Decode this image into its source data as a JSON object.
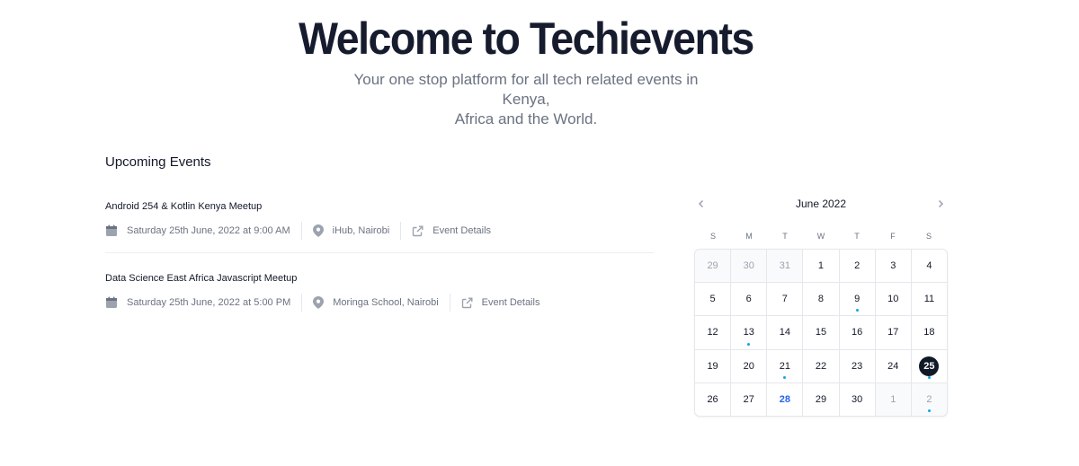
{
  "hero": {
    "title": "Welcome to Techievents",
    "subtitle_line1": "Your one stop platform for all tech related events in Kenya,",
    "subtitle_line2": "Africa and the World."
  },
  "upcoming": {
    "title": "Upcoming Events",
    "events": [
      {
        "title": "Android 254 & Kotlin Kenya Meetup",
        "datetime": "Saturday 25th June, 2022 at 9:00 AM",
        "location": "iHub, Nairobi",
        "link_label": "Event Details"
      },
      {
        "title": "Data Science East Africa Javascript Meetup",
        "datetime": "Saturday 25th June, 2022 at 5:00 PM",
        "location": "Moringa School, Nairobi",
        "link_label": "Event Details"
      }
    ]
  },
  "calendar": {
    "month_label": "June 2022",
    "weekdays": [
      "S",
      "M",
      "T",
      "W",
      "T",
      "F",
      "S"
    ],
    "days": [
      {
        "label": "29",
        "current_month": false,
        "dot": false
      },
      {
        "label": "30",
        "current_month": false,
        "dot": false
      },
      {
        "label": "31",
        "current_month": false,
        "dot": false
      },
      {
        "label": "1",
        "current_month": true,
        "dot": false
      },
      {
        "label": "2",
        "current_month": true,
        "dot": false
      },
      {
        "label": "3",
        "current_month": true,
        "dot": false
      },
      {
        "label": "4",
        "current_month": true,
        "dot": false
      },
      {
        "label": "5",
        "current_month": true,
        "dot": false
      },
      {
        "label": "6",
        "current_month": true,
        "dot": false
      },
      {
        "label": "7",
        "current_month": true,
        "dot": false
      },
      {
        "label": "8",
        "current_month": true,
        "dot": false
      },
      {
        "label": "9",
        "current_month": true,
        "dot": true
      },
      {
        "label": "10",
        "current_month": true,
        "dot": false
      },
      {
        "label": "11",
        "current_month": true,
        "dot": false
      },
      {
        "label": "12",
        "current_month": true,
        "dot": false
      },
      {
        "label": "13",
        "current_month": true,
        "dot": true
      },
      {
        "label": "14",
        "current_month": true,
        "dot": false
      },
      {
        "label": "15",
        "current_month": true,
        "dot": false
      },
      {
        "label": "16",
        "current_month": true,
        "dot": false
      },
      {
        "label": "17",
        "current_month": true,
        "dot": false
      },
      {
        "label": "18",
        "current_month": true,
        "dot": false
      },
      {
        "label": "19",
        "current_month": true,
        "dot": false
      },
      {
        "label": "20",
        "current_month": true,
        "dot": false
      },
      {
        "label": "21",
        "current_month": true,
        "dot": true
      },
      {
        "label": "22",
        "current_month": true,
        "dot": false
      },
      {
        "label": "23",
        "current_month": true,
        "dot": false
      },
      {
        "label": "24",
        "current_month": true,
        "dot": false
      },
      {
        "label": "25",
        "current_month": true,
        "dot": true,
        "selected": true
      },
      {
        "label": "26",
        "current_month": true,
        "dot": false
      },
      {
        "label": "27",
        "current_month": true,
        "dot": false
      },
      {
        "label": "28",
        "current_month": true,
        "dot": false,
        "today": true
      },
      {
        "label": "29",
        "current_month": true,
        "dot": false
      },
      {
        "label": "30",
        "current_month": true,
        "dot": false
      },
      {
        "label": "1",
        "current_month": false,
        "dot": false
      },
      {
        "label": "2",
        "current_month": false,
        "dot": true
      }
    ]
  },
  "colors": {
    "heading": "#161b2e",
    "muted": "#6b7280",
    "today": "#2563eb",
    "selected_bg": "#111827",
    "event_dot": "#0ea5e9"
  },
  "icons": {
    "date": "calendar-icon",
    "location": "map-pin-icon",
    "link": "external-link-icon",
    "prev": "chevron-left-icon",
    "next": "chevron-right-icon"
  }
}
